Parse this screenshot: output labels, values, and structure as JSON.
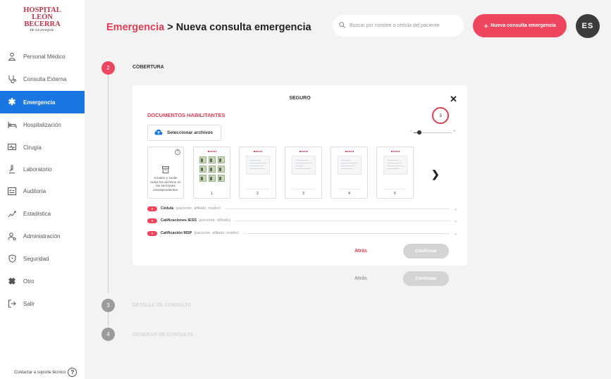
{
  "sidebar": {
    "logo": {
      "line1": "HOSPITAL",
      "line2": "LEÓN",
      "line3": "BECERRA",
      "line4": "DE GUAYAQUIL"
    },
    "items": [
      {
        "label": "Personal Médico",
        "icon": "doctor-icon",
        "active": false
      },
      {
        "label": "Consulta Externa",
        "icon": "stethoscope-icon",
        "active": false
      },
      {
        "label": "Emergencia",
        "icon": "asterisk-icon",
        "active": true
      },
      {
        "label": "Hospitalización",
        "icon": "bed-icon",
        "active": false
      },
      {
        "label": "Cirugía",
        "icon": "surgery-icon",
        "active": false
      },
      {
        "label": "Laboratorio",
        "icon": "microscope-icon",
        "active": false
      },
      {
        "label": "Auditoría",
        "icon": "audit-icon",
        "active": false
      },
      {
        "label": "Estadística",
        "icon": "chart-icon",
        "active": false
      },
      {
        "label": "Administración",
        "icon": "admin-icon",
        "active": false
      },
      {
        "label": "Seguridad",
        "icon": "shield-icon",
        "active": false
      },
      {
        "label": "Otro",
        "icon": "bandage-icon",
        "active": false
      },
      {
        "label": "Salir",
        "icon": "logout-icon",
        "active": false
      }
    ],
    "support": "Contactar a soporte técnico"
  },
  "header": {
    "breadcrumb": "Emergencia",
    "separator": " > ",
    "title": "Nueva consulta emergencia",
    "search_placeholder": "Buscar por nombre o cédula del paciente",
    "new_button": "Nueva consulta emergencia",
    "avatar_initials": "ES"
  },
  "steps": [
    {
      "number": "2",
      "label": "COBERTURA",
      "state": "active"
    },
    {
      "number": "3",
      "label": "DETALLE DE CONSULTA",
      "state": "disabled"
    },
    {
      "number": "4",
      "label": "GENERAR DE CONSULTA",
      "state": "disabled"
    }
  ],
  "modal": {
    "title": "SEGURO",
    "section_label": "DOCUMENTOS HABILITANTES",
    "count": "3",
    "select_button": "Seleccionar archivos",
    "dropzone_text": "Arrastre y suelte todos los archivos en las secciones correspondientes.",
    "thumbnails": [
      "1",
      "2",
      "3",
      "4",
      "5"
    ],
    "categories": [
      {
        "badge": "0",
        "name": "Cédula",
        "detail": "(paciente, afiliado, madre)"
      },
      {
        "badge": "0",
        "name": "Calificaciones IESS",
        "detail": "(paciente, afiliado)"
      },
      {
        "badge": "0",
        "name": "Calificación MSP",
        "detail": "(paciente, afiliado, madre)"
      }
    ],
    "back": "Atrás",
    "confirm": "Confirmar"
  },
  "footer_actions": {
    "back": "Atrás",
    "continue": "Continuar"
  },
  "colors": {
    "accent": "#ef4660",
    "nav_active": "#1976e3",
    "disabled": "#d4d4d4"
  }
}
